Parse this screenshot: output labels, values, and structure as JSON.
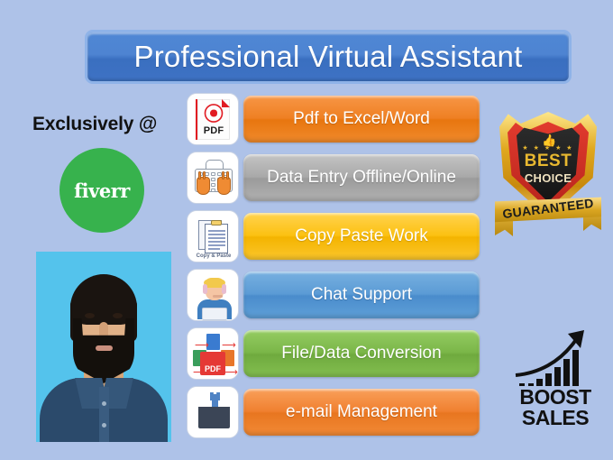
{
  "poster": {
    "title": "Professional Virtual Assistant",
    "background_color": "#aec2e8",
    "title_bar_color": "#4a7fcd"
  },
  "exclusively": {
    "label": "Exclusively @",
    "platform": "fiverr",
    "platform_color": "#37b24d"
  },
  "services": [
    {
      "label": "Pdf to Excel/Word",
      "color": "#ef8023",
      "icon": "pdf-file-icon",
      "icon_text": "PDF"
    },
    {
      "label": "Data Entry Offline/Online",
      "color": "#a9a9a9",
      "icon": "keyboard-typing-hands-icon",
      "icon_text": ""
    },
    {
      "label": "Copy Paste Work",
      "color": "#fcc112",
      "icon": "clipboard-copy-paste-icon",
      "icon_text": "Copy & Paste"
    },
    {
      "label": "Chat Support",
      "color": "#5b9bd5",
      "icon": "support-agent-headset-icon",
      "icon_text": ""
    },
    {
      "label": "File/Data Conversion",
      "color": "#7ab648",
      "icon": "file-conversion-icon",
      "icon_text": "PDF"
    },
    {
      "label": "e-mail Management",
      "color": "#f08030",
      "icon": "envelope-wrench-icon",
      "icon_text": ""
    }
  ],
  "badge": {
    "line1": "BEST",
    "line2": "CHOICE",
    "ribbon": "GUARANTEED",
    "stars": "★ ★ ★ ★ ★",
    "gold_color": "#e8b830"
  },
  "boost": {
    "line1": "BOOST",
    "line2": "SALES"
  }
}
